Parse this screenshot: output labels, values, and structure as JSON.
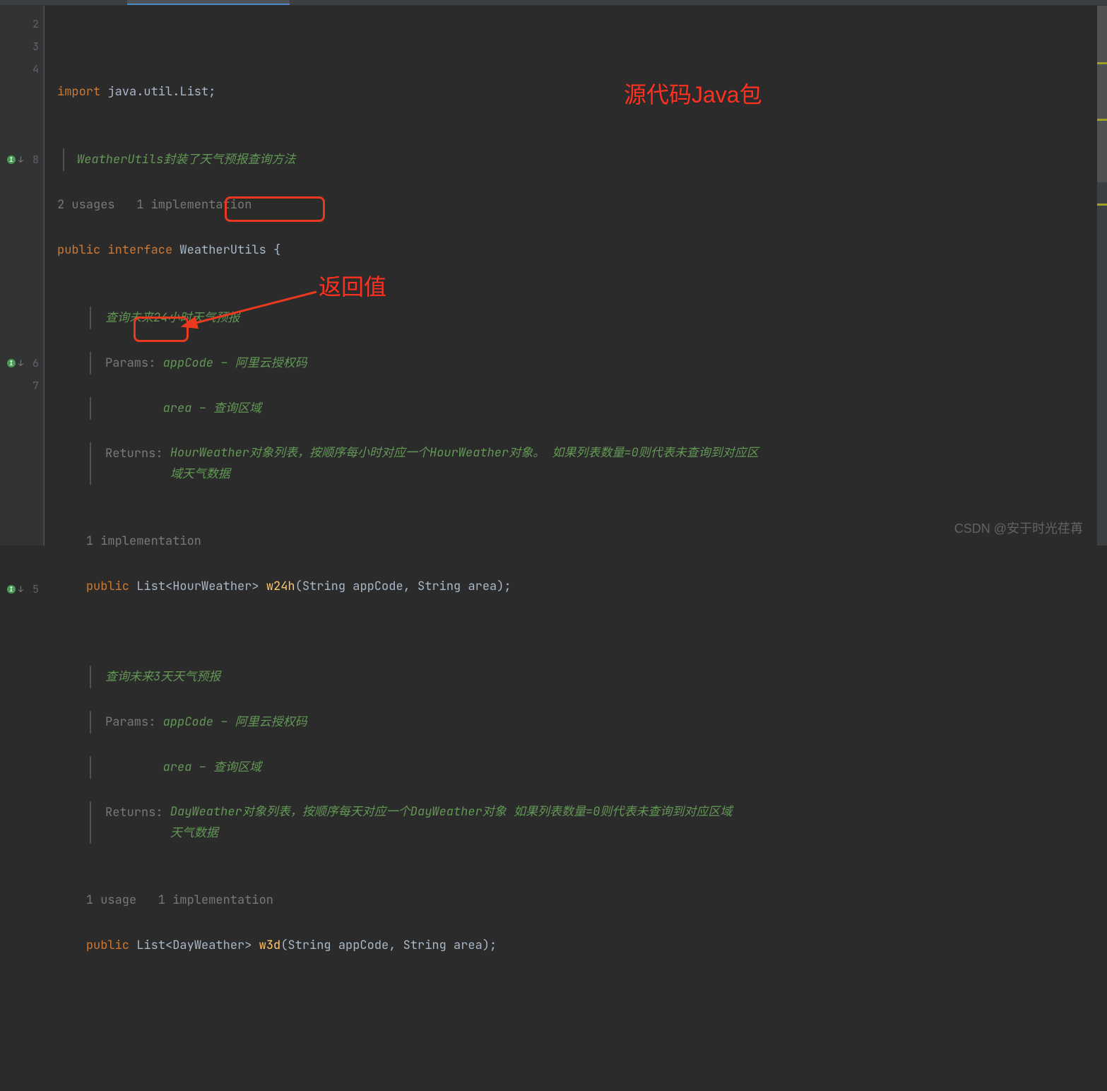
{
  "gutter_lines": [
    "2",
    "3",
    "4",
    "",
    "",
    "",
    "8",
    "",
    "",
    "",
    "",
    "",
    "",
    "",
    "",
    "6",
    "7",
    "",
    "",
    "",
    "",
    "",
    "",
    "",
    "",
    "5"
  ],
  "impl_rows": [
    6,
    15,
    25
  ],
  "code": {
    "line3_kw": "import",
    "line3_pkg": "java.util.List",
    "doc1": "WeatherUtils封装了天气预报查询方法",
    "hint1": "2 usages   1 implementation",
    "line8_kw1": "public",
    "line8_kw2": "interface",
    "line8_name": "WeatherUtils",
    "m1": {
      "title": "查询未来24小时天气预报",
      "params_label": "Params:",
      "p1_name": "appCode",
      "p1_desc": "阿里云授权码",
      "p2_name": "area",
      "p2_desc": "查询区域",
      "returns_label": "Returns:",
      "returns_text": "HourWeather对象列表，按顺序每小时对应一个HourWeather对象。 如果列表数量=0则代表未查询到对应区域天气数据",
      "hint": "1 implementation",
      "kw": "public",
      "ret_type": "List<HourWeather>",
      "name": "w24h",
      "sig": "(String appCode, String area);"
    },
    "m2": {
      "title": "查询未来3天天气预报",
      "params_label": "Params:",
      "p1_name": "appCode",
      "p1_desc": "阿里云授权码",
      "p2_name": "area",
      "p2_desc": "查询区域",
      "returns_label": "Returns:",
      "returns_text": "DayWeather对象列表，按顺序每天对应一个DayWeather对象 如果列表数量=0则代表未查询到对应区域天气数据",
      "hint": "1 usage   1 implementation",
      "kw": "public",
      "ret_type": "List<DayWeather>",
      "name": "w3d",
      "sig": "(String appCode, String area);"
    }
  },
  "annotations": {
    "top": "源代码Java包",
    "return": "返回值"
  },
  "watermark": "CSDN @安于时光荏苒"
}
